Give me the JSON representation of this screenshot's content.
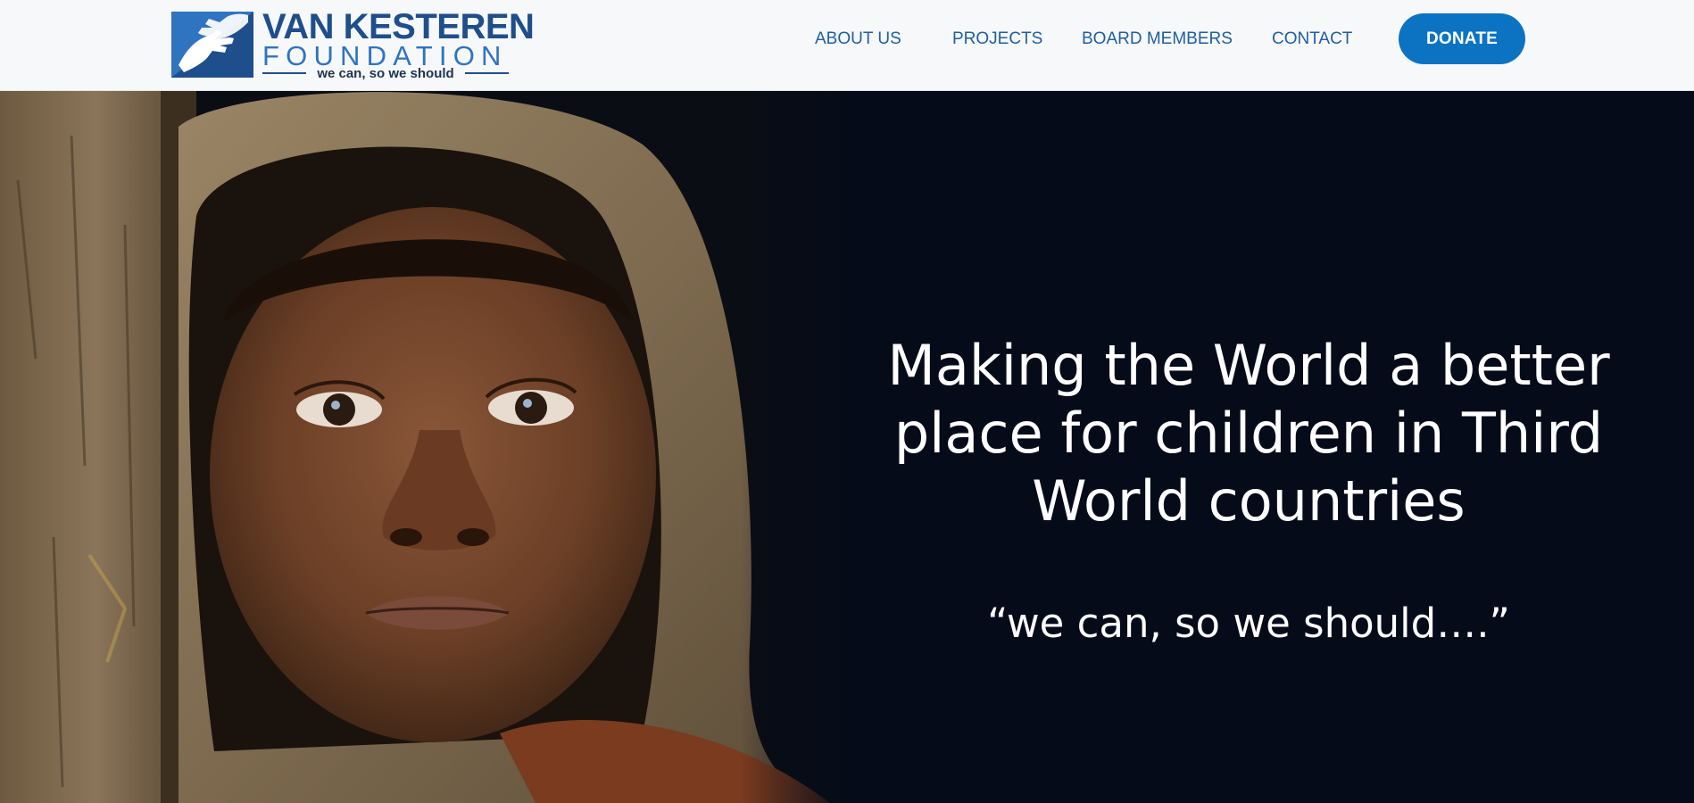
{
  "header": {
    "logo": {
      "line1": "VAN KESTEREN",
      "line2": "FOUNDATION",
      "tagline": "we can, so we should",
      "icon": "hands-logo-icon"
    },
    "nav": [
      {
        "label": "ABOUT US"
      },
      {
        "label": "PROJECTS"
      },
      {
        "label": "BOARD MEMBERS"
      },
      {
        "label": "CONTACT"
      }
    ],
    "donate_label": "DONATE"
  },
  "hero": {
    "title": "Making the World a better place for children in Third World countries",
    "quote": "“we can, so we should….”",
    "image": "child-in-hood-photo"
  },
  "colors": {
    "brand_blue": "#1e4f8c",
    "nav_text": "#1f5f9f",
    "donate_bg": "#0b73c2",
    "hero_bg": "#050b19",
    "header_bg": "#f7f8fa"
  }
}
